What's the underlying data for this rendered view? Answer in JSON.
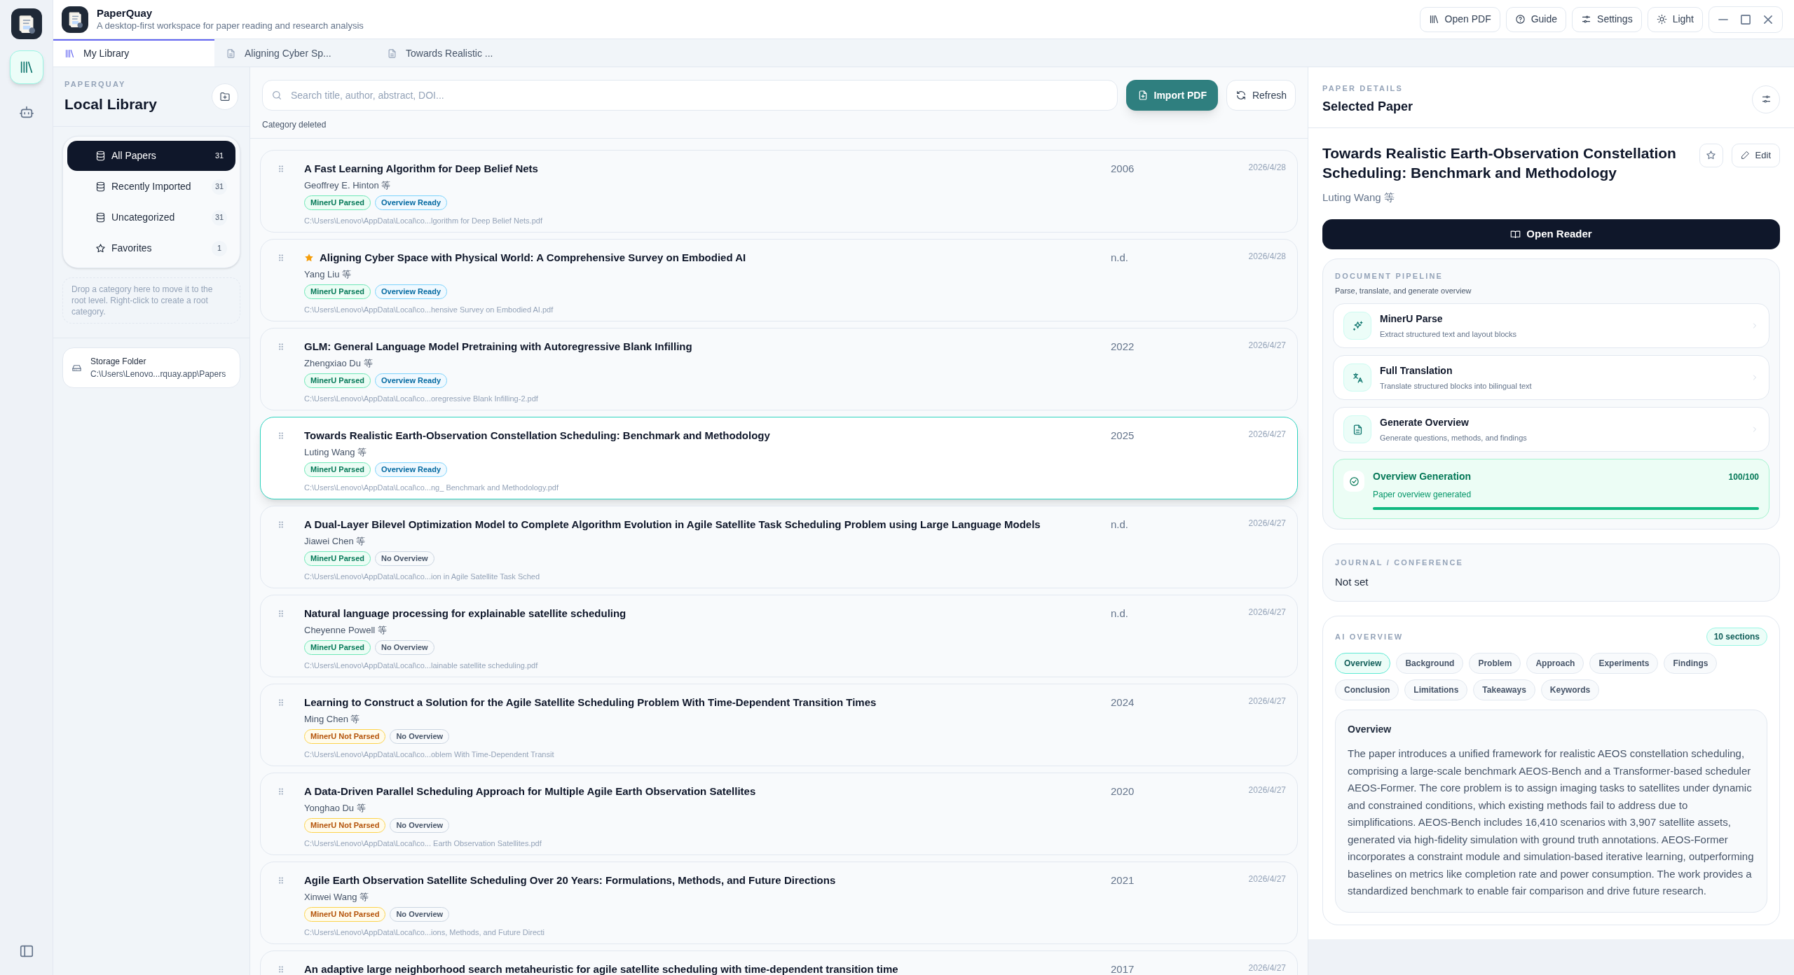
{
  "app": {
    "name": "PaperQuay",
    "subtitle": "A desktop-first workspace for paper reading and research analysis"
  },
  "rail": [
    {
      "kind": "library",
      "selected": true
    },
    {
      "kind": "robot",
      "selected": false
    }
  ],
  "toolbar": [
    "Open PDF",
    "Guide",
    "Settings",
    "Light"
  ],
  "tabs": [
    {
      "label": "My Library",
      "kind": "library",
      "selected": true
    },
    {
      "label": "Aligning Cyber Sp...",
      "kind": "doc",
      "selected": false
    },
    {
      "label": "Towards Realistic ...",
      "kind": "doc",
      "selected": false
    }
  ],
  "sidebar": {
    "eyebrow": "PAPERQUAY",
    "title": "Local Library",
    "categories": [
      {
        "label": "All Papers",
        "count": "31",
        "kind": "db",
        "selected": true
      },
      {
        "label": "Recently Imported",
        "count": "31",
        "kind": "db",
        "selected": false
      },
      {
        "label": "Uncategorized",
        "count": "31",
        "kind": "db",
        "selected": false
      },
      {
        "label": "Favorites",
        "count": "1",
        "kind": "star",
        "selected": false
      }
    ],
    "drop_hint": "Drop a category here to move it to the root level. Right-click to create a root category.",
    "storage": {
      "label": "Storage Folder",
      "path": "C:\\Users\\Lenovo...rquay.app\\Papers"
    }
  },
  "search": {
    "placeholder": "Search title, author, abstract, DOI..."
  },
  "import_button": "Import PDF",
  "refresh_button": "Refresh",
  "notice": "Category deleted",
  "papers": [
    {
      "title": "A Fast Learning Algorithm for Deep Belief Nets",
      "starred": false,
      "authors": "Geoffrey E. Hinton 等",
      "tags": [
        {
          "label": "MinerU Parsed",
          "kind": "parsed"
        },
        {
          "label": "Overview Ready",
          "kind": "ready"
        }
      ],
      "path": "C:\\Users\\Lenovo\\AppData\\Local\\co...lgorithm for Deep Belief Nets.pdf",
      "year": "2006",
      "date": "2026/4/28",
      "selected": false
    },
    {
      "title": "Aligning Cyber Space with Physical World: A Comprehensive Survey on Embodied AI",
      "starred": true,
      "authors": "Yang Liu 等",
      "tags": [
        {
          "label": "MinerU Parsed",
          "kind": "parsed"
        },
        {
          "label": "Overview Ready",
          "kind": "ready"
        }
      ],
      "path": "C:\\Users\\Lenovo\\AppData\\Local\\co...hensive Survey on Embodied AI.pdf",
      "year": "n.d.",
      "date": "2026/4/28",
      "selected": false
    },
    {
      "title": "GLM: General Language Model Pretraining with Autoregressive Blank Infilling",
      "starred": false,
      "authors": "Zhengxiao Du 等",
      "tags": [
        {
          "label": "MinerU Parsed",
          "kind": "parsed"
        },
        {
          "label": "Overview Ready",
          "kind": "ready"
        }
      ],
      "path": "C:\\Users\\Lenovo\\AppData\\Local\\co...oregressive Blank Infilling-2.pdf",
      "year": "2022",
      "date": "2026/4/27",
      "selected": false
    },
    {
      "title": "Towards Realistic Earth-Observation Constellation Scheduling: Benchmark and Methodology",
      "starred": false,
      "authors": "Luting Wang 等",
      "tags": [
        {
          "label": "MinerU Parsed",
          "kind": "parsed"
        },
        {
          "label": "Overview Ready",
          "kind": "ready"
        }
      ],
      "path": "C:\\Users\\Lenovo\\AppData\\Local\\co...ng_ Benchmark and Methodology.pdf",
      "year": "2025",
      "date": "2026/4/27",
      "selected": true
    },
    {
      "title": "A Dual-Layer Bilevel Optimization Model to Complete Algorithm Evolution in Agile Satellite Task Scheduling Problem using Large Language Models",
      "starred": false,
      "authors": "Jiawei Chen 等",
      "tags": [
        {
          "label": "MinerU Parsed",
          "kind": "parsed"
        },
        {
          "label": "No Overview",
          "kind": "none"
        }
      ],
      "path": "C:\\Users\\Lenovo\\AppData\\Local\\co...ion in Agile Satellite Task Sched",
      "year": "n.d.",
      "date": "2026/4/27",
      "selected": false
    },
    {
      "title": "Natural language processing for explainable satellite scheduling",
      "starred": false,
      "authors": "Cheyenne Powell 等",
      "tags": [
        {
          "label": "MinerU Parsed",
          "kind": "parsed"
        },
        {
          "label": "No Overview",
          "kind": "none"
        }
      ],
      "path": "C:\\Users\\Lenovo\\AppData\\Local\\co...lainable satellite scheduling.pdf",
      "year": "n.d.",
      "date": "2026/4/27",
      "selected": false
    },
    {
      "title": "Learning to Construct a Solution for the Agile Satellite Scheduling Problem With Time-Dependent Transition Times",
      "starred": false,
      "authors": "Ming Chen 等",
      "tags": [
        {
          "label": "MinerU Not Parsed",
          "kind": "not_parsed"
        },
        {
          "label": "No Overview",
          "kind": "none"
        }
      ],
      "path": "C:\\Users\\Lenovo\\AppData\\Local\\co...oblem With Time-Dependent Transit",
      "year": "2024",
      "date": "2026/4/27",
      "selected": false
    },
    {
      "title": "A Data-Driven Parallel Scheduling Approach for Multiple Agile Earth Observation Satellites",
      "starred": false,
      "authors": "Yonghao Du 等",
      "tags": [
        {
          "label": "MinerU Not Parsed",
          "kind": "not_parsed"
        },
        {
          "label": "No Overview",
          "kind": "none"
        }
      ],
      "path": "C:\\Users\\Lenovo\\AppData\\Local\\co... Earth Observation Satellites.pdf",
      "year": "2020",
      "date": "2026/4/27",
      "selected": false
    },
    {
      "title": "Agile Earth Observation Satellite Scheduling Over 20 Years: Formulations, Methods, and Future Directions",
      "starred": false,
      "authors": "Xinwei Wang 等",
      "tags": [
        {
          "label": "MinerU Not Parsed",
          "kind": "not_parsed"
        },
        {
          "label": "No Overview",
          "kind": "none"
        }
      ],
      "path": "C:\\Users\\Lenovo\\AppData\\Local\\co...ions, Methods, and Future Directi",
      "year": "2021",
      "date": "2026/4/27",
      "selected": false
    },
    {
      "title": "An adaptive large neighborhood search metaheuristic for agile satellite scheduling with time-dependent transition time",
      "starred": false,
      "year": "2017",
      "date": "2026/4/27",
      "selected": false
    }
  ],
  "details": {
    "eyebrow": "PAPER DETAILS",
    "title": "Selected Paper",
    "paper_title": "Towards Realistic Earth-Observation Constellation Scheduling: Benchmark and Methodology",
    "starred": false,
    "edit_button": "Edit",
    "authors": "Luting Wang 等",
    "open_reader": "Open Reader",
    "pipeline": {
      "eyebrow": "DOCUMENT PIPELINE",
      "subtitle": "Parse, translate, and generate overview",
      "steps": [
        {
          "title": "MinerU Parse",
          "desc": "Extract structured text and layout blocks",
          "kind": "sparkle"
        },
        {
          "title": "Full Translation",
          "desc": "Translate structured blocks into bilingual text",
          "kind": "translate"
        },
        {
          "title": "Generate Overview",
          "desc": "Generate questions, methods, and findings",
          "kind": "doc"
        }
      ],
      "progress": {
        "title": "Overview Generation",
        "count": "100/100",
        "status": "Paper overview generated",
        "level": 1
      }
    },
    "journal": {
      "eyebrow": "JOURNAL / CONFERENCE",
      "value": "Not set"
    },
    "overview": {
      "eyebrow": "AI OVERVIEW",
      "badge": "10 sections",
      "sections": [
        {
          "label": "Overview",
          "selected": true
        },
        {
          "label": "Background",
          "selected": false
        },
        {
          "label": "Problem",
          "selected": false
        },
        {
          "label": "Approach",
          "selected": false
        },
        {
          "label": "Experiments",
          "selected": false
        },
        {
          "label": "Findings",
          "selected": false
        },
        {
          "label": "Conclusion",
          "selected": false
        },
        {
          "label": "Limitations",
          "selected": false
        },
        {
          "label": "Takeaways",
          "selected": false
        },
        {
          "label": "Keywords",
          "selected": false
        }
      ],
      "content_title": "Overview",
      "content": "The paper introduces a unified framework for realistic AEOS constellation scheduling, comprising a large-scale benchmark AEOS-Bench and a Transformer-based scheduler AEOS-Former. The core problem is to assign imaging tasks to satellites under dynamic and constrained conditions, which existing methods fail to address due to simplifications. AEOS-Bench includes 16,410 scenarios with 3,907 satellite assets, generated via high-fidelity simulation with ground truth annotations. AEOS-Former incorporates a constraint module and simulation-based iterative learning, outperforming baselines on metrics like completion rate and power consumption. The work provides a standardized benchmark to enable fair comparison and drive future research."
    }
  }
}
